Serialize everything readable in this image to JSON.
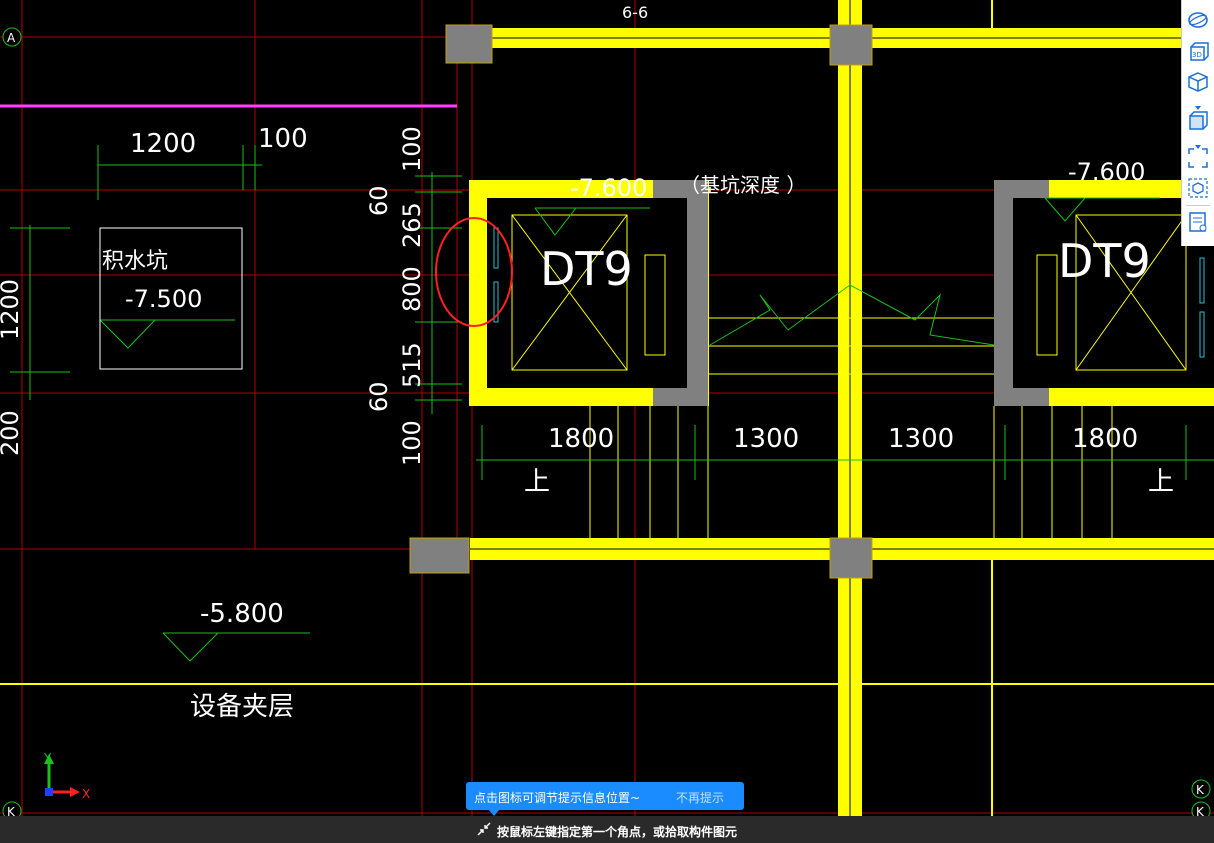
{
  "drawing": {
    "section_label": "6-6",
    "axis_a": "A",
    "axis_k": "K",
    "sump_label": "积水坑",
    "sump_elev": "-7.500",
    "floor_elev": "-5.800",
    "interlayer_label": "设备夹层",
    "pit_elev_left": "-7.600",
    "pit_elev_right": "-7.600",
    "pit_depth_note": "（基坑深度    ）",
    "elevator_left": "DT9",
    "elevator_right": "DT9",
    "stair_up_left": "上",
    "stair_up_right": "上",
    "dim_top": [
      "1200",
      "100"
    ],
    "dim_left_vertical": [
      "100",
      "60",
      "265",
      "800",
      "515",
      "60",
      "100"
    ],
    "dim_left_edge": [
      "1200",
      "200"
    ],
    "dim_bottom": [
      "1800",
      "1300",
      "1300",
      "1800"
    ],
    "axis_y": "Y",
    "axis_x": "X"
  },
  "toolbar": {
    "icons": [
      "orbit-icon",
      "3d-view-icon",
      "cube-view-icon",
      "box-view-icon",
      "fit-window-icon",
      "dynamic-view-icon",
      "properties-icon"
    ],
    "label_3d": "3D"
  },
  "tooltip": {
    "text": "点击图标可调节提示信息位置~",
    "dismiss": "不再提示"
  },
  "status": {
    "prompt": "按鼠标左键指定第一个角点，或拾取构件图元"
  },
  "colors": {
    "background": "#000000",
    "beam": "#ffff00",
    "column": "#808080",
    "axis": "#c00000",
    "dimension": "#19c119",
    "accent": "#1a8cff"
  }
}
